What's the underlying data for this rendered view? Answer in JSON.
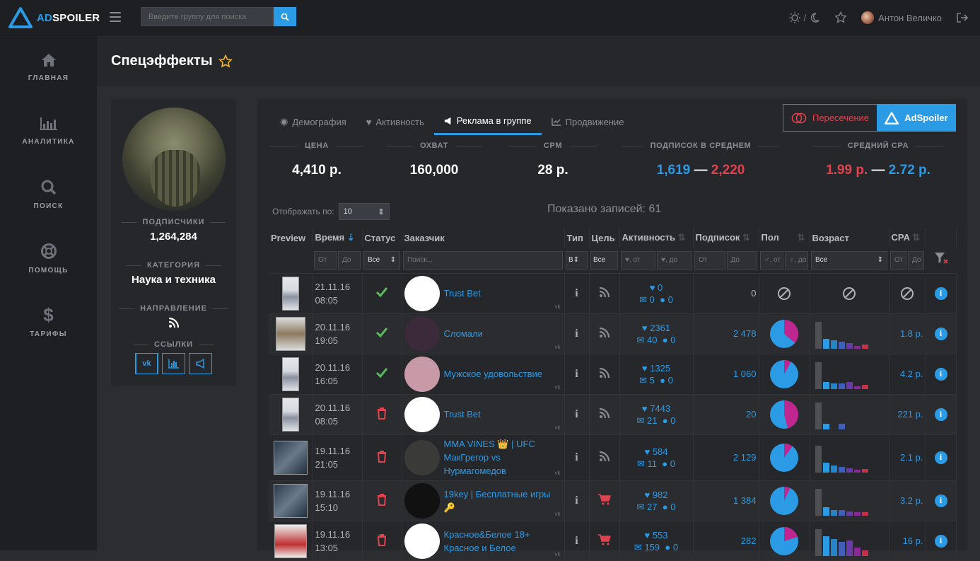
{
  "app": {
    "logo_text": "AdSpoiler",
    "search_placeholder": "Введите группу для поиска",
    "theme_sep": "/",
    "user_name": "Антон Величко"
  },
  "sidebar": {
    "items": [
      {
        "label": "ГЛАВНАЯ",
        "icon": "home-icon"
      },
      {
        "label": "АНАЛИТИКА",
        "icon": "bar-chart-icon"
      },
      {
        "label": "ПОИСК",
        "icon": "search-icon"
      },
      {
        "label": "ПОМОЩЬ",
        "icon": "lifebuoy-icon"
      },
      {
        "label": "ТАРИФЫ",
        "icon": "dollar-icon"
      }
    ]
  },
  "page": {
    "title": "Спецэффекты"
  },
  "profile": {
    "subs_label": "ПОДПИСЧИКИ",
    "subs_value": "1,264,284",
    "cat_label": "КАТЕГОРИЯ",
    "cat_value": "Наука и техника",
    "dir_label": "НАПРАВЛЕНИЕ",
    "links_label": "ССЫЛКИ"
  },
  "tabs": [
    "Демография",
    "Активность",
    "Реклама в группе",
    "Продвижение"
  ],
  "buttons": {
    "intersection": "Пересечение",
    "adspoiler": "AdSpoiler"
  },
  "stats": {
    "price_label": "ЦЕНА",
    "price": "4,410 р.",
    "reach_label": "ОХВАТ",
    "reach": "160,000",
    "cpm_label": "CPM",
    "cpm": "28 р.",
    "subs_label": "ПОДПИСОК В СРЕДНЕМ",
    "subs_min": "1,619",
    "subs_dash": "—",
    "subs_max": "2,220",
    "cpa_label": "СРЕДНИЙ CPA",
    "cpa_min": "1.99 р.",
    "cpa_dash": "—",
    "cpa_max": "2.72 р."
  },
  "table": {
    "perpage_label": "Отображать по:",
    "perpage_value": "10",
    "shown": "Показано записей: 61",
    "headers": [
      "Preview",
      "Время",
      "Статус",
      "Заказчик",
      "Тип",
      "Цель",
      "Активность",
      "Подписок",
      "Пол",
      "Возраст",
      "CPA"
    ],
    "filters": {
      "from": "От",
      "to": "До",
      "status": "Все",
      "search": "Поиск...",
      "type": "В",
      "goal": "Все",
      "act_from": "♥, от",
      "act_to": "♥, до",
      "sex_from": "♂, от",
      "sex_to": "♀, до",
      "age": "Все"
    },
    "rows": [
      {
        "date": "21.11.16",
        "time": "08:05",
        "status": "ok",
        "name": "Trust Bet",
        "likes": "0",
        "reposts": "0",
        "comments": "0",
        "subs": "0",
        "pie": null,
        "age": null,
        "cpa": null
      },
      {
        "date": "20.11.16",
        "time": "19:05",
        "status": "ok",
        "name": "Сломали",
        "likes": "2361",
        "reposts": "40",
        "comments": "0",
        "subs": "2 478",
        "pie": 0.36,
        "age": [
          0.95,
          0.35,
          0.3,
          0.25,
          0.2,
          0.1,
          0.15
        ],
        "cpa": "1.8 р."
      },
      {
        "date": "20.11.16",
        "time": "16:05",
        "status": "ok",
        "name": "Мужское удовольствие",
        "likes": "1325",
        "reposts": "5",
        "comments": "0",
        "subs": "1 060",
        "pie": 0.08,
        "age": [
          0.95,
          0.25,
          0.2,
          0.2,
          0.25,
          0.1,
          0.15
        ],
        "cpa": "4.2 р."
      },
      {
        "date": "20.11.16",
        "time": "08:05",
        "status": "del",
        "name": "Trust Bet",
        "likes": "7443",
        "reposts": "21",
        "comments": "0",
        "subs": "20",
        "pie": 0.46,
        "age": [
          0.95,
          0.2,
          0,
          0.2,
          0,
          0,
          0
        ],
        "cpa": "221 р."
      },
      {
        "date": "19.11.16",
        "time": "21:05",
        "status": "del",
        "name": "MMA VINES 👑 | UFC МакГрегор vs Нурмагомедов",
        "likes": "584",
        "reposts": "11",
        "comments": "0",
        "subs": "2 129",
        "pie": 0.1,
        "age": [
          0.95,
          0.35,
          0.25,
          0.2,
          0.15,
          0.1,
          0.12
        ],
        "cpa": "2.1 р."
      },
      {
        "date": "19.11.16",
        "time": "15:10",
        "status": "del",
        "name": "19key | Бесплатные игры🔑",
        "likes": "982",
        "reposts": "27",
        "comments": "0",
        "subs": "1 384",
        "pie": 0.07,
        "age": [
          0.95,
          0.3,
          0.2,
          0.2,
          0.15,
          0.12,
          0.12
        ],
        "cpa": "3.2 р."
      },
      {
        "date": "19.11.16",
        "time": "13:05",
        "status": "del",
        "name": "Красное&Белое 18+ Красное и Белое",
        "likes": "553",
        "reposts": "159",
        "comments": "0",
        "subs": "282",
        "pie": 0.2,
        "age": [
          0.95,
          0.7,
          0.6,
          0.5,
          0.55,
          0.3,
          0.2
        ],
        "cpa": "16 р."
      }
    ]
  },
  "colors": {
    "accent": "#2c9be6",
    "danger": "#e0434d",
    "ok": "#5cb85c",
    "pie_female": "#c0268f",
    "age_bars": [
      "#4e5054",
      "#2c9be6",
      "#2585c8",
      "#3f5fb8",
      "#6a3aa8",
      "#8a2a98",
      "#c8304a"
    ]
  }
}
